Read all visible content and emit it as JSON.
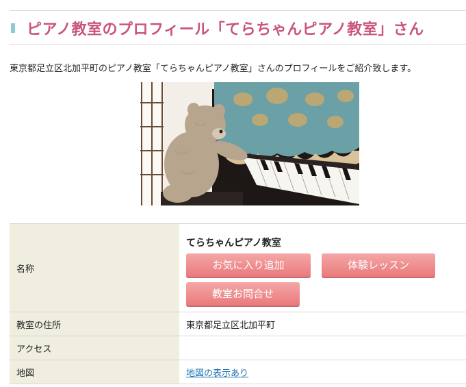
{
  "header": {
    "title": "ピアノ教室のプロフィール「てらちゃんピアノ教室」さん"
  },
  "intro": {
    "text": "東京都足立区北加平町のピアノ教室「てらちゃんピアノ教室」さんのプロフィールをご紹介致します。"
  },
  "photo": {
    "description": "teddy bear playing upright piano"
  },
  "profile": {
    "name_label": "名称",
    "name_value": "てらちゃんピアノ教室",
    "buttons": {
      "favorite": "お気に入り追加",
      "trial": "体験レッスン",
      "inquiry": "教室お問合せ"
    },
    "address_label": "教室の住所",
    "address_value": "東京都足立区北加平町",
    "access_label": "アクセス",
    "access_value": "",
    "map_label": "地図",
    "map_link": "地図の表示あり"
  },
  "colors": {
    "title": "#c9557a",
    "accent_mark": "#8fcbd6",
    "label_bg": "#f0eedf",
    "button": "#ea7a7c",
    "link": "#1a6fb0"
  }
}
